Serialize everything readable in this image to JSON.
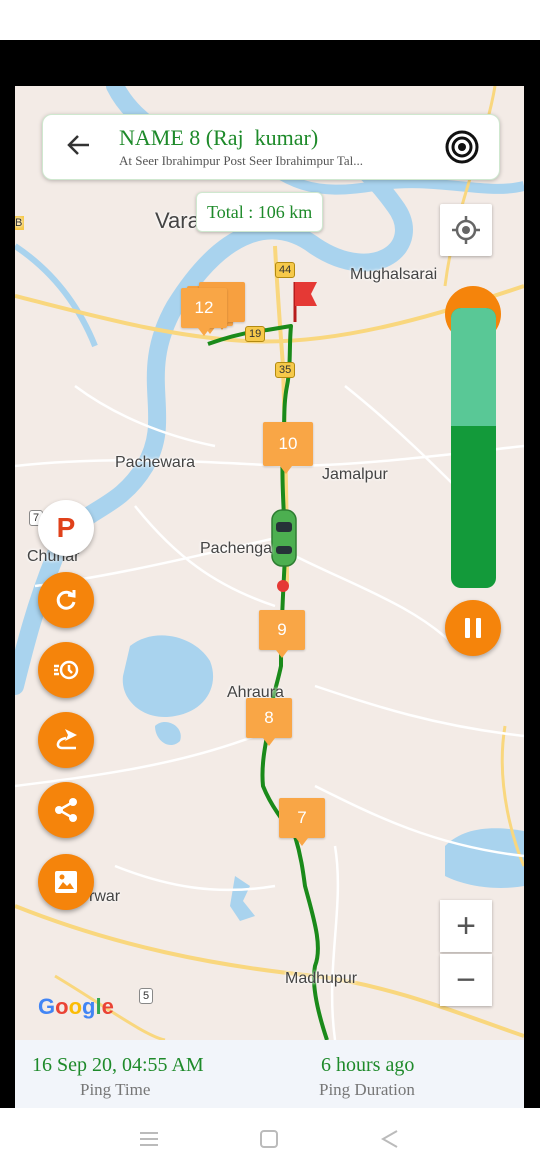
{
  "header": {
    "title": "NAME 8 (Raj  kumar)",
    "address": "At Seer Ibrahimpur Post Seer Ibrahimpur Tal...",
    "back_icon": "arrow-left-icon",
    "target_icon": "target-icon"
  },
  "map": {
    "total_distance": "Total : 106 km",
    "places": {
      "varanasi": "Vara",
      "mughalsarai": "Mughalsarai",
      "pachewara": "Pachewara",
      "jamalpur": "Jamalpur",
      "pachenga": "Pachenga",
      "chunar": "Chunar",
      "ahraura": "Ahraura",
      "rwar": "rwar",
      "madhupur": "Madhupur",
      "b_label": "B"
    },
    "highways": [
      "44",
      "19",
      "35",
      "5",
      "7"
    ],
    "stop_markers": [
      "12",
      "10",
      "9",
      "8",
      "7"
    ],
    "google_logo": "Google",
    "colors": {
      "route": "#1a8a1a",
      "marker": "#f9a646",
      "accent": "#f5840b",
      "brand_green": "#1e8a2a"
    }
  },
  "playback": {
    "speed_fraction": 0.42,
    "pause_icon": "pause-icon"
  },
  "side_buttons": {
    "parking_label": "P",
    "icons": [
      "refresh-icon",
      "history-clock-icon",
      "route-icon",
      "share-icon",
      "image-icon"
    ]
  },
  "zoom": {
    "in": "+",
    "out": "−"
  },
  "footer": {
    "ping_time_value": "16 Sep 20, 04:55 AM",
    "ping_time_label": "Ping Time",
    "ping_duration_value": "6 hours ago",
    "ping_duration_label": "Ping Duration"
  },
  "navbar": {
    "icons": [
      "menu-icon",
      "home-square-icon",
      "back-triangle-icon"
    ]
  }
}
